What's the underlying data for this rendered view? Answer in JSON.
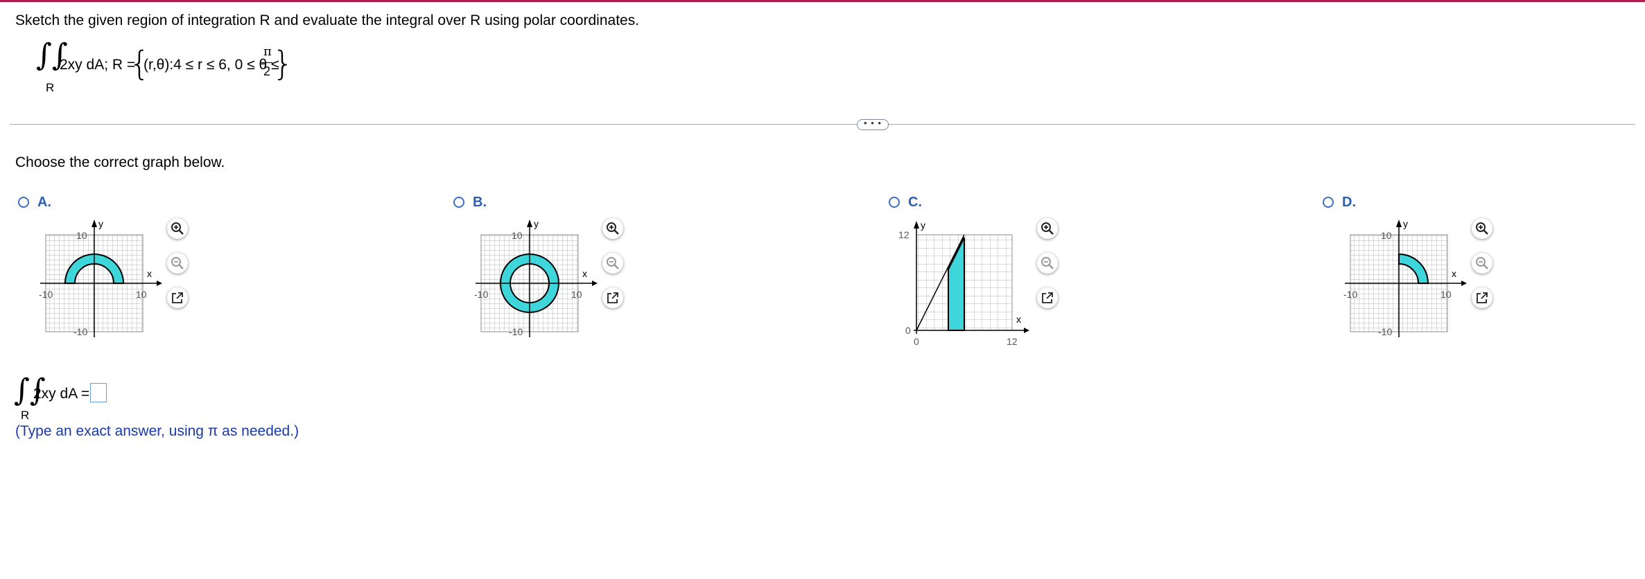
{
  "question": {
    "instruction": "Sketch the given region of integration R and evaluate the integral over R using polar coordinates.",
    "integrand": "2xy dA; R =",
    "set_open": "(r,θ):4 ≤ r ≤ 6, 0 ≤ θ ≤",
    "pi": "π",
    "two": "2",
    "region_label": "R"
  },
  "more_button": "• • •",
  "prompt": "Choose the correct graph below.",
  "options": [
    {
      "letter": "A.",
      "ticks": {
        "top": "10",
        "bottom": "-10",
        "left": "-10",
        "right": "10",
        "xlabel": "x",
        "ylabel": "y"
      }
    },
    {
      "letter": "B.",
      "ticks": {
        "top": "10",
        "bottom": "-10",
        "left": "-10",
        "right": "10",
        "xlabel": "x",
        "ylabel": "y"
      }
    },
    {
      "letter": "C.",
      "ticks": {
        "ytop": "12",
        "y0": "0",
        "x0": "0",
        "xright": "12",
        "xlabel": "x",
        "ylabel": "y"
      }
    },
    {
      "letter": "D.",
      "ticks": {
        "top": "10",
        "bottom": "-10",
        "left": "-10",
        "right": "10",
        "xlabel": "x",
        "ylabel": "y"
      }
    }
  ],
  "answer": {
    "label": "2xy dA =",
    "region_label": "R",
    "value": "",
    "hint": "(Type an exact answer, using π as needed.)"
  },
  "colors": {
    "fill": "#3ed6db",
    "accent": "#2b5fb3",
    "topbar": "#b01e4e"
  },
  "icons": [
    "zoom-in-icon",
    "zoom-out-icon",
    "external-link-icon"
  ]
}
